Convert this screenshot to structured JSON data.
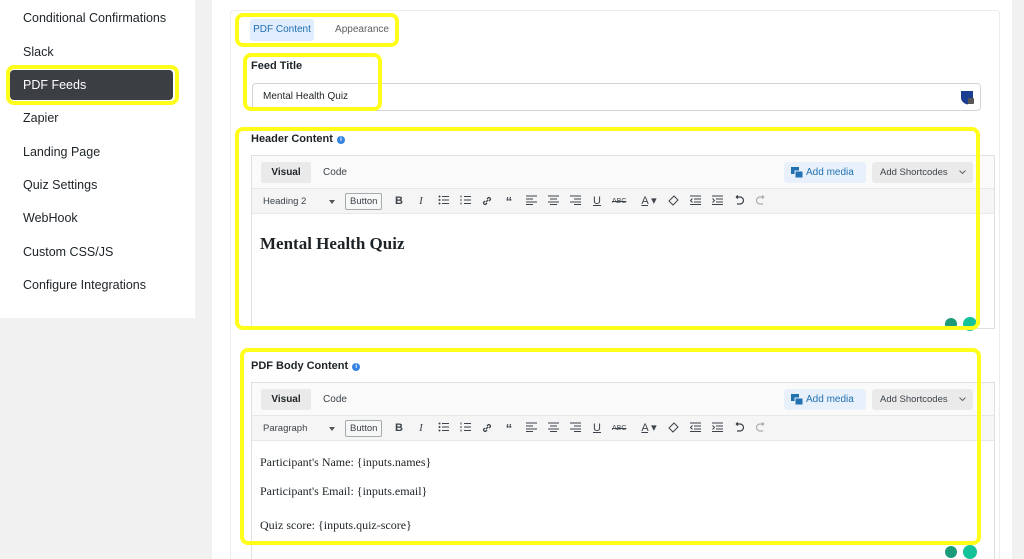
{
  "sidebar": {
    "items": [
      {
        "label": "Conditional Confirmations",
        "active": false
      },
      {
        "label": "Slack",
        "active": false
      },
      {
        "label": "PDF Feeds",
        "active": true
      },
      {
        "label": "Zapier",
        "active": false
      },
      {
        "label": "Landing Page",
        "active": false
      },
      {
        "label": "Quiz Settings",
        "active": false
      },
      {
        "label": "WebHook",
        "active": false
      },
      {
        "label": "Custom CSS/JS",
        "active": false
      },
      {
        "label": "Configure Integrations",
        "active": false
      }
    ]
  },
  "tabs": {
    "pdf_content": "PDF Content",
    "appearance": "Appearance"
  },
  "feed_title": {
    "label": "Feed Title",
    "value": "Mental Health Quiz"
  },
  "header_content": {
    "label": "Header Content",
    "visual_tab": "Visual",
    "code_tab": "Code",
    "add_media": "Add media",
    "add_shortcodes": "Add Shortcodes",
    "format": "Heading 2",
    "button_label": "Button",
    "heading_text": "Mental Health Quiz"
  },
  "body_content": {
    "label": "PDF Body Content",
    "visual_tab": "Visual",
    "code_tab": "Code",
    "add_media": "Add media",
    "add_shortcodes": "Add Shortcodes",
    "format": "Paragraph",
    "button_label": "Button",
    "lines": [
      "Participant's Name: {inputs.names}",
      "Participant's Email: {inputs.email}",
      "Quiz score: {inputs.quiz-score}"
    ]
  },
  "colors": {
    "highlight": "#ffff1a",
    "accent": "#2271b1",
    "active_sidebar": "#3b3f44"
  }
}
